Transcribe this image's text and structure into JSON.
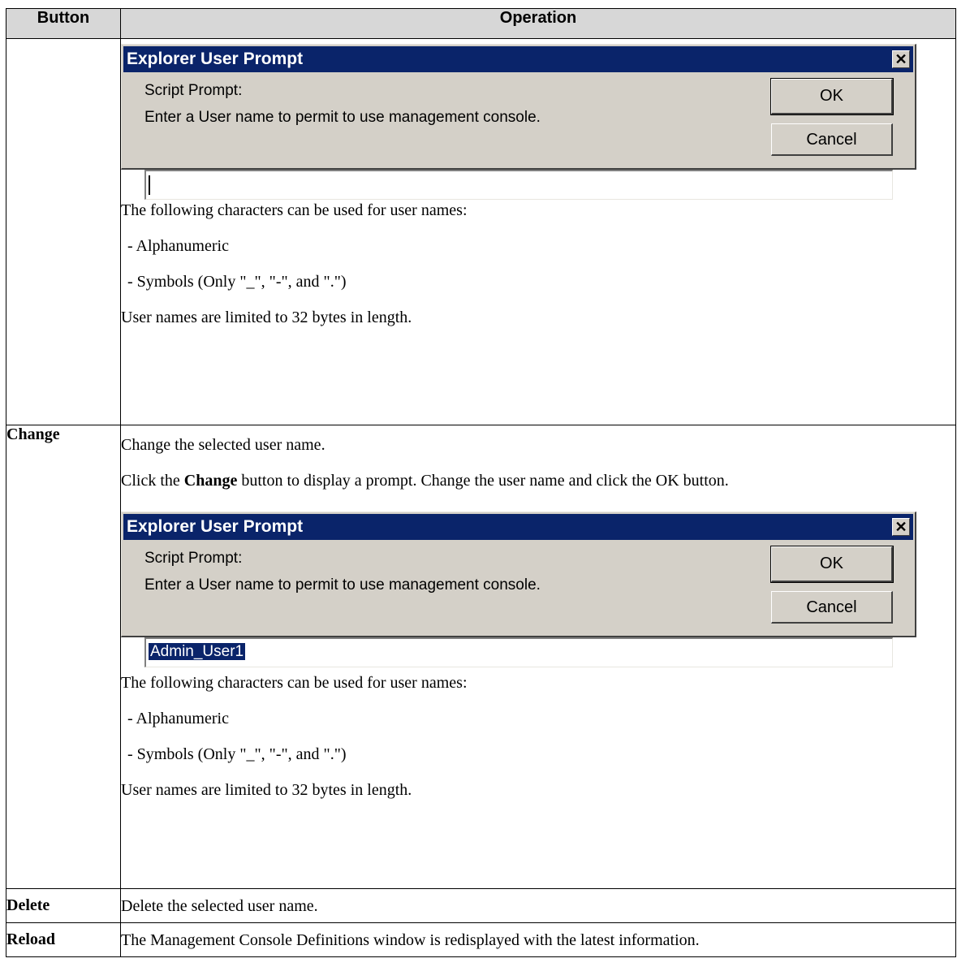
{
  "table": {
    "header": {
      "button": "Button",
      "operation": "Operation"
    }
  },
  "dialog_top": {
    "title": "Explorer User Prompt",
    "close_glyph": "✕",
    "prompt_label": "Script Prompt:",
    "message": "Enter a User name to permit to use management console.",
    "ok_label": "OK",
    "cancel_label": "Cancel",
    "input_value": ""
  },
  "row_add_notes": {
    "chars_intro": "The following characters can be used for user names:",
    "item1": "- Alphanumeric",
    "item2": "- Symbols (Only \"_\", \"-\", and \".\")",
    "limit": "User names are limited to 32 bytes in length."
  },
  "row_change": {
    "button": "Change",
    "desc": "Change the selected user name.",
    "click_prefix": "Click the ",
    "click_bold": "Change",
    "click_suffix": " button to display a prompt. Change the user name and click the OK button."
  },
  "dialog_change": {
    "title": "Explorer User Prompt",
    "close_glyph": "✕",
    "prompt_label": "Script Prompt:",
    "message": "Enter a User name to permit to use management console.",
    "ok_label": "OK",
    "cancel_label": "Cancel",
    "input_value": "Admin_User1"
  },
  "row_change_notes": {
    "chars_intro": "The following characters can be used for user names:",
    "item1": "- Alphanumeric",
    "item2": "- Symbols (Only \"_\", \"-\", and \".\")",
    "limit": "User names are limited to 32 bytes in length."
  },
  "row_delete": {
    "button": "Delete",
    "desc": "Delete the selected user name."
  },
  "row_reload": {
    "button": "Reload",
    "desc": "The Management Console Definitions window is redisplayed with the latest information."
  },
  "colors": {
    "title_bar": "#0a246a",
    "dialog_face": "#d4d0c8",
    "header_bg": "#d7d7d7"
  }
}
